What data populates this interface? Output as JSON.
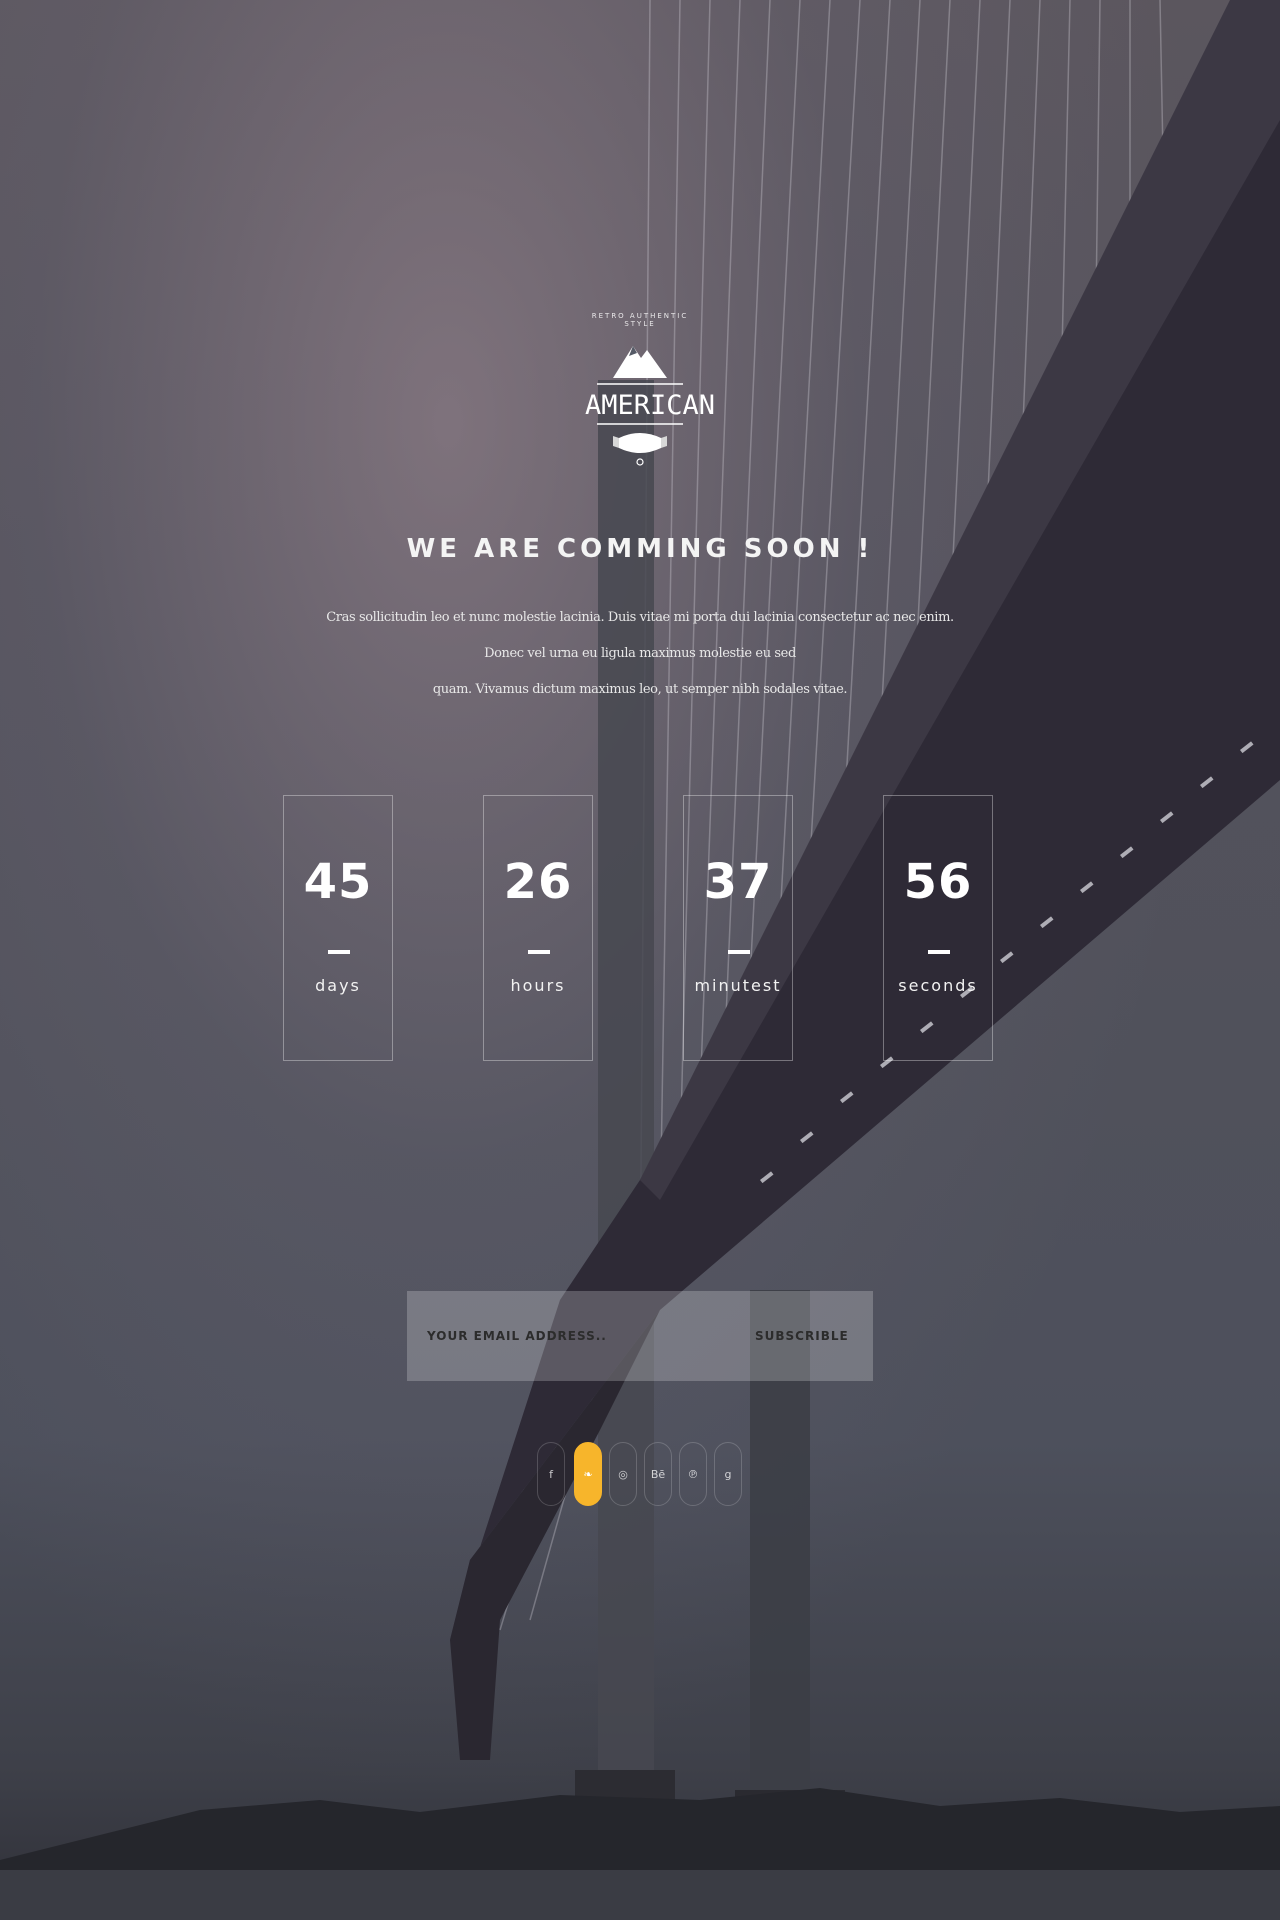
{
  "brand": {
    "logo_name": "AMERICAN",
    "logo_arc_text": "RETRO AUTHENTIC STYLE",
    "accent_color": "#f7b52b"
  },
  "hero": {
    "heading": "WE ARE COMMING SOON !",
    "description_line1": "Cras sollicitudin leo et nunc molestie lacinia. Duis vitae mi porta dui lacinia consectetur ac nec enim. Donec vel urna eu ligula maximus molestie eu sed",
    "description_line2": "quam. Vivamus dictum maximus leo, ut semper nibh sodales vitae."
  },
  "countdown": [
    {
      "value": "45",
      "label": "days"
    },
    {
      "value": "26",
      "label": "hours"
    },
    {
      "value": "37",
      "label": "minutest"
    },
    {
      "value": "56",
      "label": "seconds"
    }
  ],
  "subscribe": {
    "placeholder": "YOUR EMAIL ADDRESS..",
    "button_label": "SUBSCRIBLE"
  },
  "social": [
    {
      "icon": "facebook-icon",
      "glyph": "f",
      "active": false
    },
    {
      "icon": "twitter-icon",
      "glyph": "❧",
      "active": true
    },
    {
      "icon": "dribbble-icon",
      "glyph": "◎",
      "active": false
    },
    {
      "icon": "behance-icon",
      "glyph": "Bē",
      "active": false
    },
    {
      "icon": "pinterest-icon",
      "glyph": "℗",
      "active": false
    },
    {
      "icon": "google-plus-icon",
      "glyph": "g",
      "active": false
    }
  ]
}
